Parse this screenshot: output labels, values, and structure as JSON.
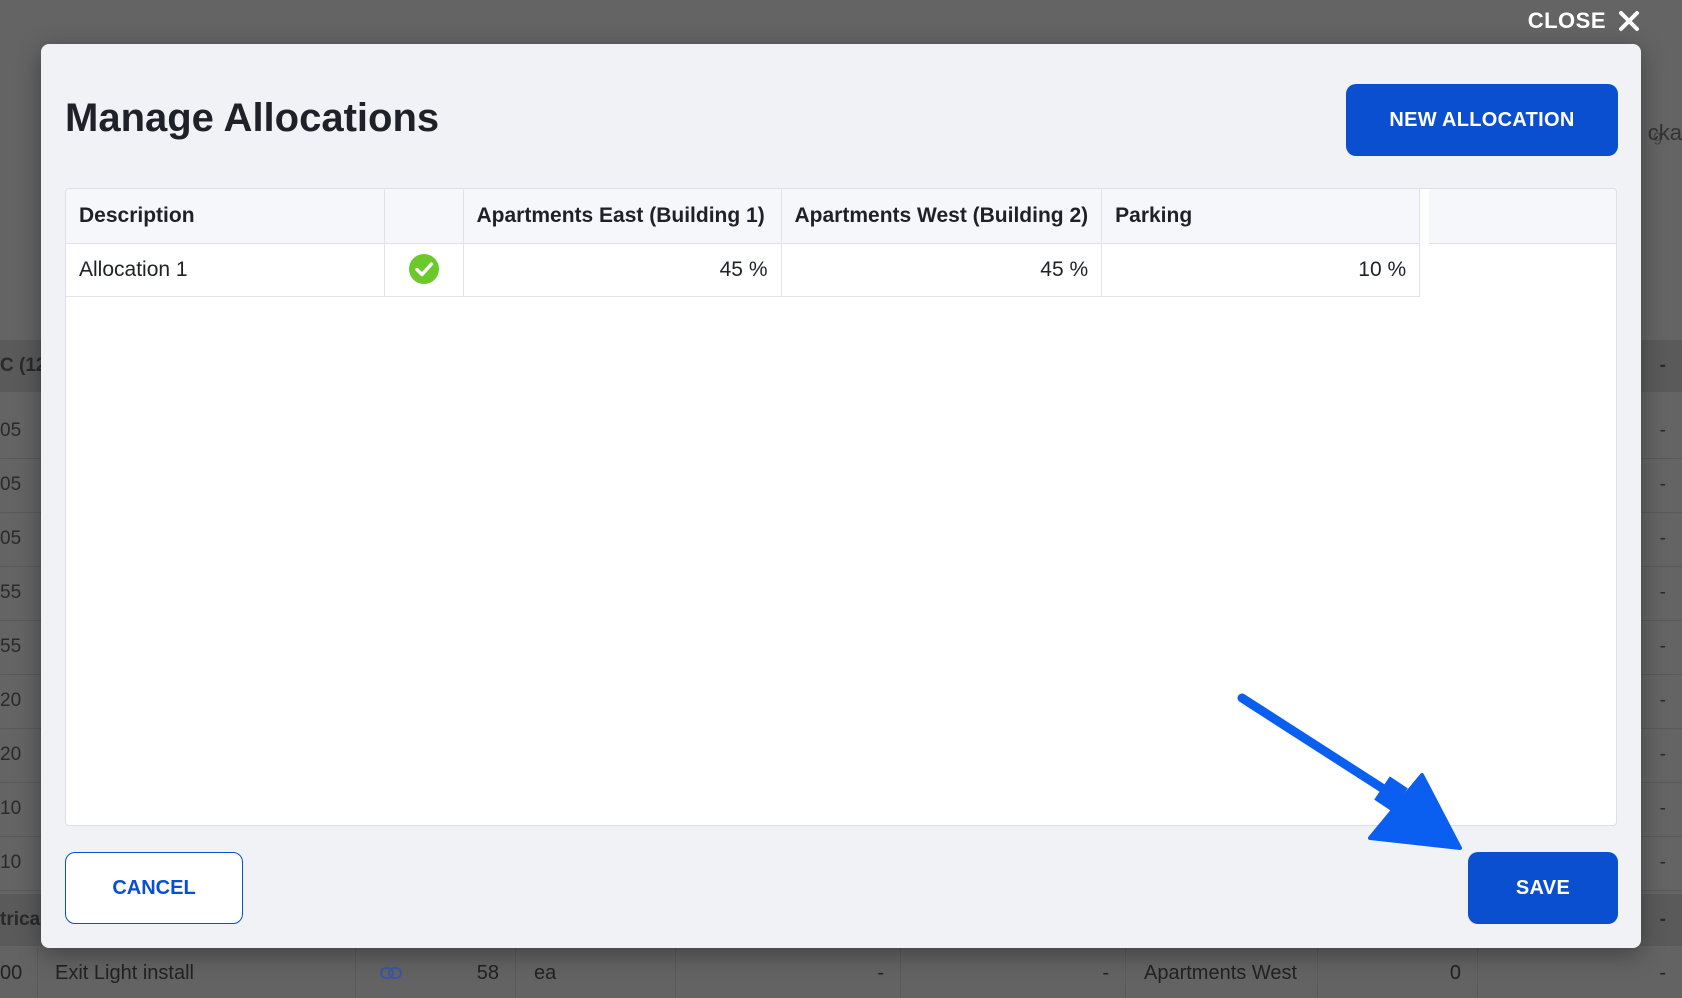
{
  "close": {
    "label": "CLOSE"
  },
  "modal": {
    "title": "Manage Allocations",
    "new_allocation_label": "NEW ALLOCATION",
    "cancel_label": "CANCEL",
    "save_label": "SAVE"
  },
  "table": {
    "columns": [
      "Description",
      "",
      "Apartments East (Building 1)",
      "Apartments West (Building 2)",
      "Parking"
    ],
    "rows": [
      {
        "description": "Allocation 1",
        "status_icon": "check-circle-icon",
        "apartments_east": "45 %",
        "apartments_west": "45 %",
        "parking": "10 %"
      }
    ]
  },
  "background": {
    "top_right_small": "g",
    "top_right_text": "cka",
    "group_row_1": "C (12",
    "rows": [
      "05",
      "05",
      "05",
      "55",
      "55",
      "20",
      "20",
      "10",
      "10"
    ],
    "group_row_2": "trica",
    "last_row": {
      "code": "00",
      "name": "Exit Light install",
      "link_icon": "link-icon",
      "qty": "58",
      "unit": "ea",
      "dash1": "-",
      "dash2": "-",
      "allocation": "Apartments West",
      "zero": "0",
      "dash3": "-"
    },
    "dash": "-"
  },
  "colors": {
    "primary": "#0a4fd0",
    "success": "#6cc92a",
    "annotation": "#0a5ef0"
  }
}
